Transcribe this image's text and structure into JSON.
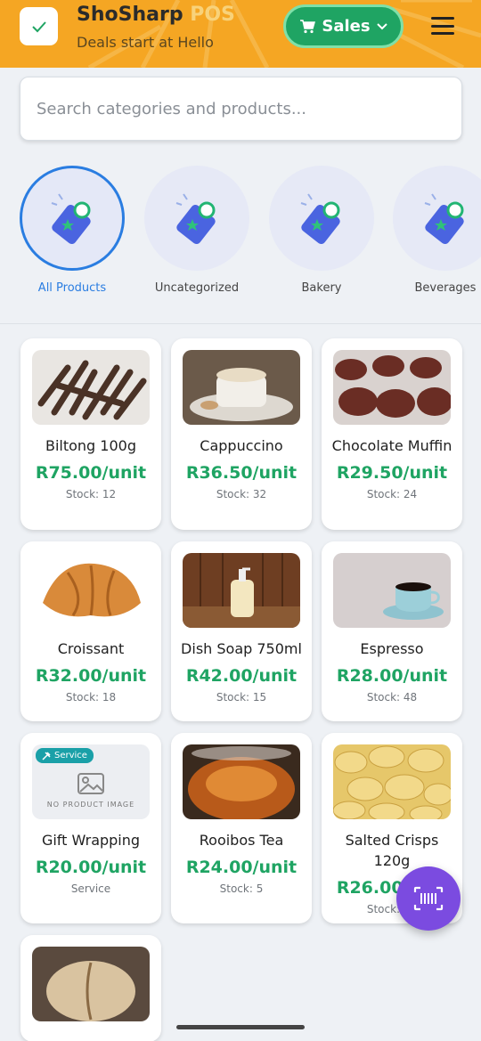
{
  "header": {
    "title_main": "ShoSharp ",
    "title_accent": "POS",
    "subtitle": "Deals start at Hello",
    "mode_label": "Sales"
  },
  "search": {
    "placeholder": "Search categories and products..."
  },
  "categories": [
    {
      "label": "All Products",
      "active": true
    },
    {
      "label": "Uncategorized",
      "active": false
    },
    {
      "label": "Bakery",
      "active": false
    },
    {
      "label": "Beverages",
      "active": false
    }
  ],
  "products": [
    {
      "name": "Biltong 100g",
      "price": "R75.00/unit",
      "stock": "Stock: 12",
      "image": "biltong"
    },
    {
      "name": "Cappuccino",
      "price": "R36.50/unit",
      "stock": "Stock: 32",
      "image": "cappuccino"
    },
    {
      "name": "Chocolate Muffin",
      "price": "R29.50/unit",
      "stock": "Stock: 24",
      "image": "muffin"
    },
    {
      "name": "Croissant",
      "price": "R32.00/unit",
      "stock": "Stock: 18",
      "image": "croissant"
    },
    {
      "name": "Dish Soap 750ml",
      "price": "R42.00/unit",
      "stock": "Stock: 15",
      "image": "soap"
    },
    {
      "name": "Espresso",
      "price": "R28.00/unit",
      "stock": "Stock: 48",
      "image": "espresso"
    },
    {
      "name": "Gift Wrapping",
      "price": "R20.00/unit",
      "stock": "Service",
      "image": "none",
      "badge": "Service",
      "no_image_text": "NO PRODUCT IMAGE"
    },
    {
      "name": "Rooibos Tea",
      "price": "R24.00/unit",
      "stock": "Stock: 5",
      "image": "tea"
    },
    {
      "name": "Salted Crisps 120g",
      "price": "R26.00/unit",
      "stock": "Stock: 30",
      "image": "crisps"
    },
    {
      "name": "",
      "price": "",
      "stock": "",
      "image": "bread"
    }
  ],
  "icons": {
    "logo": "check-icon",
    "sales": "cart-icon",
    "dropdown": "chevron-down-icon",
    "menu": "hamburger-menu-icon",
    "category": "price-tag-icon",
    "fab": "barcode-scanner-icon"
  },
  "colors": {
    "header": "#f5a623",
    "sales_button": "#1fa463",
    "price": "#1fa463",
    "active": "#2a7de1",
    "fab": "#7b4be0"
  }
}
